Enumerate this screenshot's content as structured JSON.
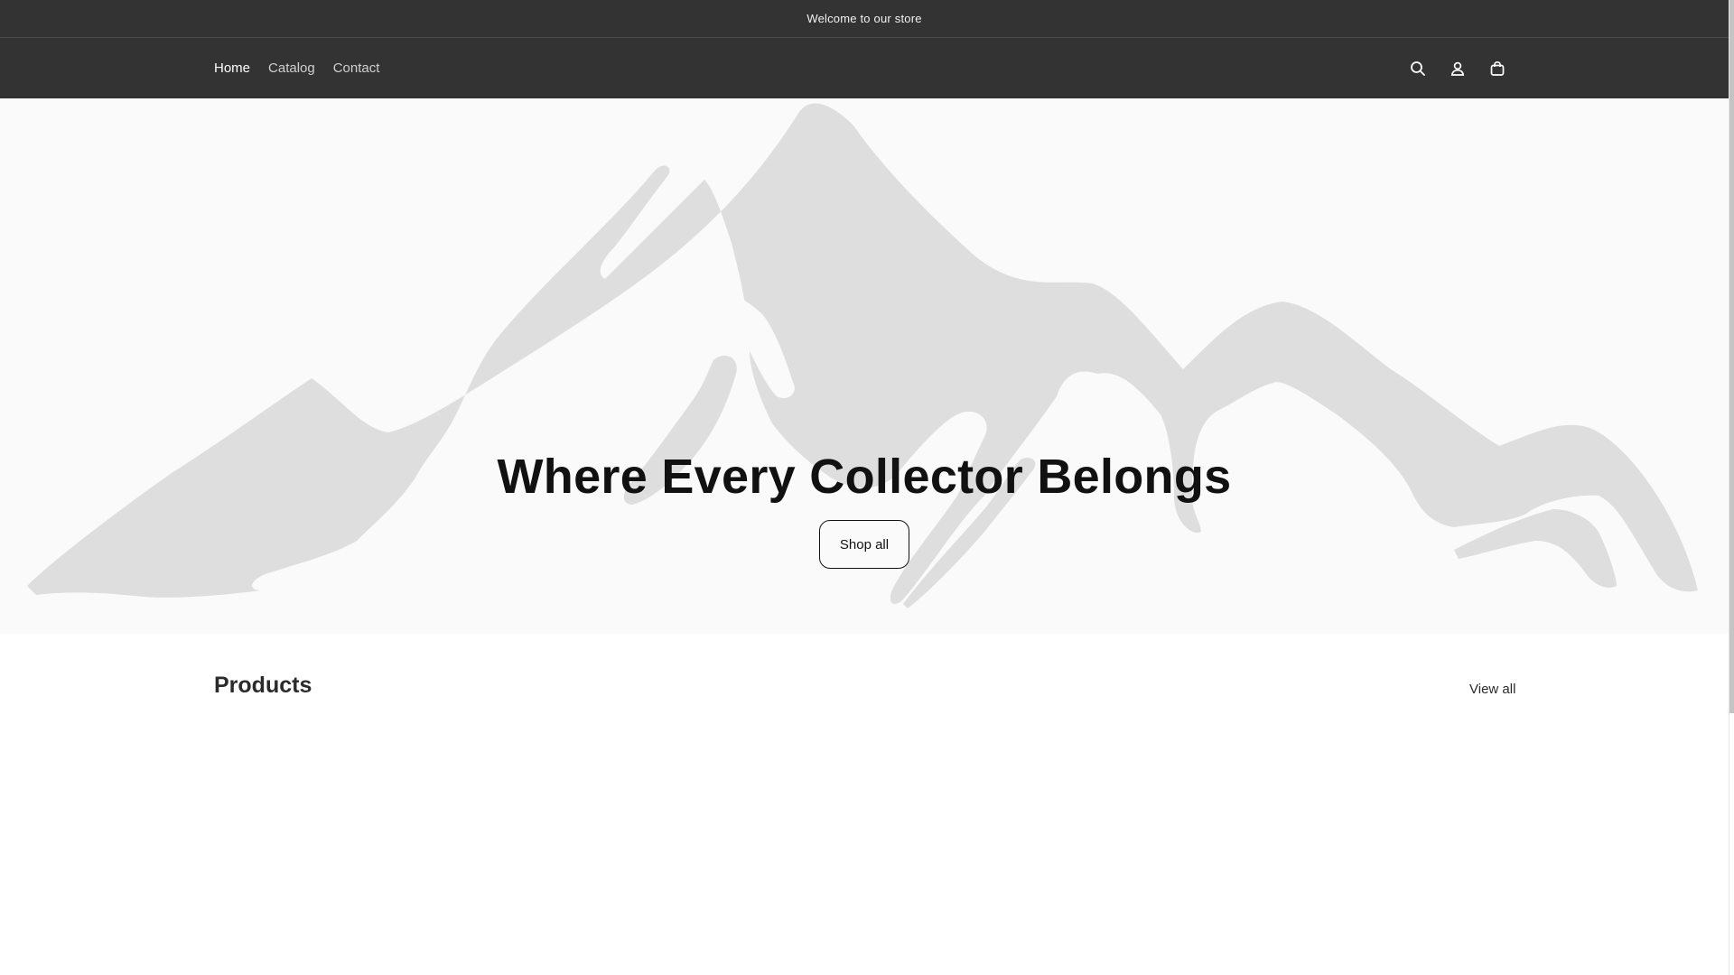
{
  "announcement": {
    "text": "Welcome to our store"
  },
  "header": {
    "nav": [
      {
        "label": "Home",
        "active": true
      },
      {
        "label": "Catalog",
        "active": false
      },
      {
        "label": "Contact",
        "active": false
      }
    ],
    "icons": [
      "search-icon",
      "account-icon",
      "cart-icon"
    ]
  },
  "hero": {
    "title": "Where Every Collector Belongs",
    "button_label": "Shop all",
    "background_icon": "mountain-placeholder"
  },
  "products": {
    "heading": "Products",
    "view_all_label": "View all"
  },
  "colors": {
    "header_bg": "#333333",
    "hero_bg": "#fafafa",
    "mountain_fill": "#dcdcdc",
    "text_dark": "#111111"
  }
}
